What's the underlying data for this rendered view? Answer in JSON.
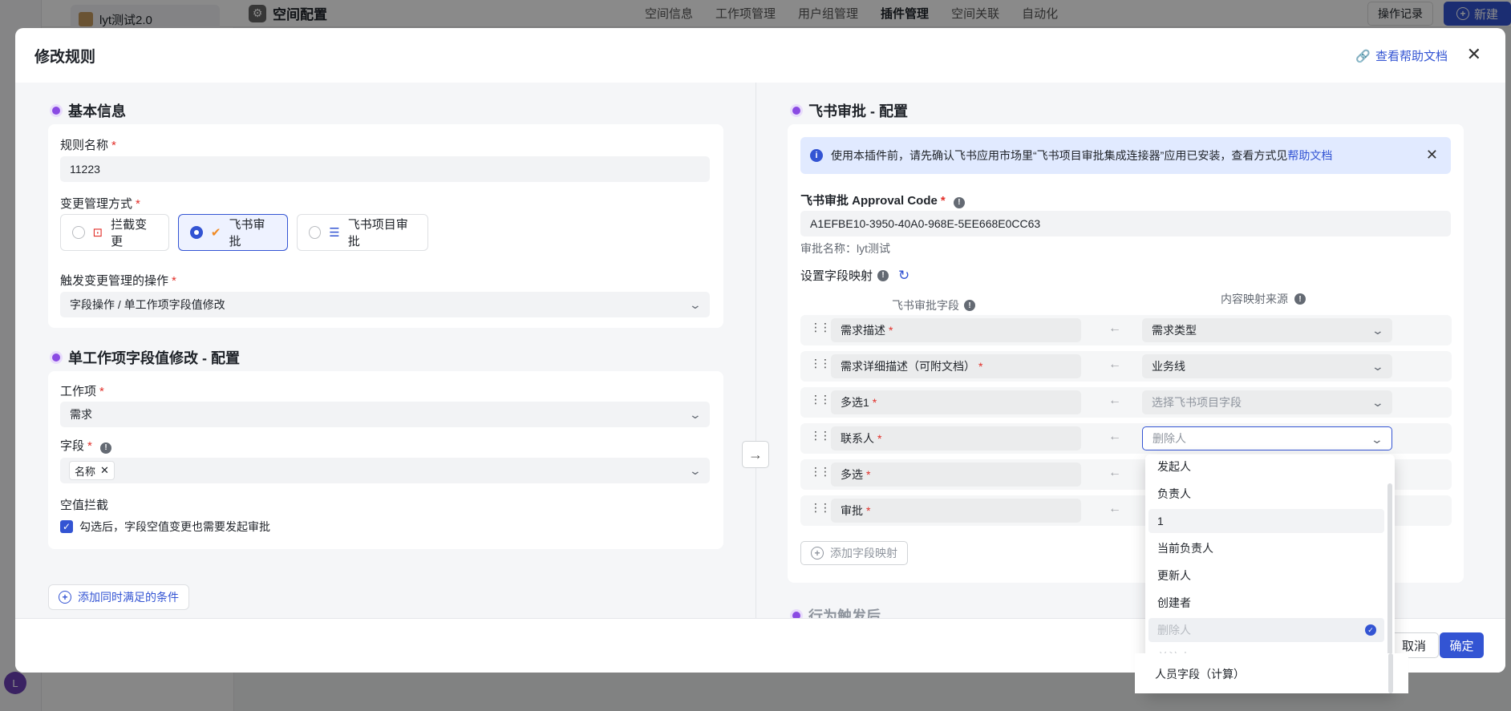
{
  "background": {
    "project_name": "lyt测试2.0",
    "page_title": "空间配置",
    "nav_tabs": [
      "空间信息",
      "工作项管理",
      "用户组管理",
      "插件管理",
      "空间关联",
      "自动化"
    ],
    "active_tab": "插件管理",
    "log_button": "操作记录",
    "new_button": "新建",
    "avatar_letter": "L"
  },
  "modal": {
    "title": "修改规则",
    "help_link": "查看帮助文档",
    "cancel": "取消",
    "confirm": "确定"
  },
  "basic": {
    "title": "基本信息",
    "rule_name_label": "规则名称",
    "rule_name_value": "11223",
    "mode_label": "变更管理方式",
    "modes": [
      "拦截变更",
      "飞书审批",
      "飞书项目审批"
    ],
    "selected_mode": "飞书审批",
    "trigger_label": "触发变更管理的操作",
    "trigger_value": "字段操作 / 单工作项字段值修改"
  },
  "single": {
    "title": "单工作项字段值修改 - 配置",
    "workitem_label": "工作项",
    "workitem_value": "需求",
    "field_label": "字段",
    "field_tag": "名称",
    "empty_label": "空值拦截",
    "empty_checkbox": "勾选后，字段空值变更也需要发起审批",
    "add_condition": "添加同时满足的条件"
  },
  "approval": {
    "title": "飞书审批 - 配置",
    "notice_text": "使用本插件前，请先确认飞书应用市场里“飞书项目审批集成连接器”应用已安装，查看方式见",
    "notice_link": "帮助文档",
    "code_label": "飞书审批 Approval Code",
    "code_value": "A1EFBE10-3950-40A0-968E-5EE668E0CC63",
    "approval_name": "审批名称：lyt测试",
    "mapping_label": "设置字段映射",
    "col_left": "飞书审批字段",
    "col_right": "内容映射来源",
    "rows": [
      {
        "left": "需求描述",
        "right": "需求类型"
      },
      {
        "left": "需求详细描述（可附文档）",
        "right": "业务线"
      },
      {
        "left": "多选1",
        "right": "选择飞书项目字段"
      },
      {
        "left": "联系人",
        "right": "删除人"
      },
      {
        "left": "多选",
        "right": ""
      },
      {
        "left": "审批",
        "right": ""
      }
    ],
    "add_mapping": "添加字段映射",
    "next_section_partial": "行为触发后"
  },
  "dropdown": {
    "items": [
      "发起人",
      "负责人",
      "1",
      "当前负责人",
      "更新人",
      "创建者",
      "删除人",
      "关注人",
      "人员字段（计算）"
    ],
    "hover_item": "1",
    "selected_item": "删除人"
  }
}
